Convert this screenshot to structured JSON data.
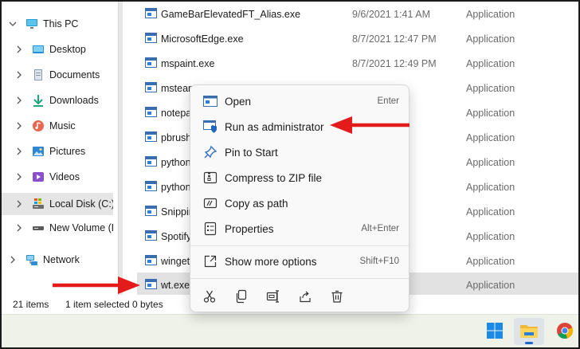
{
  "nav": {
    "items": [
      {
        "label": "This PC",
        "icon": "monitor-icon",
        "expanded": true
      },
      {
        "label": "Desktop",
        "icon": "desktop-icon"
      },
      {
        "label": "Documents",
        "icon": "documents-icon"
      },
      {
        "label": "Downloads",
        "icon": "download-icon"
      },
      {
        "label": "Music",
        "icon": "music-icon"
      },
      {
        "label": "Pictures",
        "icon": "pictures-icon"
      },
      {
        "label": "Videos",
        "icon": "videos-icon"
      },
      {
        "label": "Local Disk (C:)",
        "icon": "drive-icon",
        "selected": true
      },
      {
        "label": "New Volume (D",
        "icon": "drive-icon"
      },
      {
        "label": "Network",
        "icon": "network-icon"
      }
    ]
  },
  "files": [
    {
      "name": "GameBarElevatedFT_Alias.exe",
      "date": "9/6/2021 1:41 AM",
      "type": "Application"
    },
    {
      "name": "MicrosoftEdge.exe",
      "date": "8/7/2021 12:47 PM",
      "type": "Application"
    },
    {
      "name": "mspaint.exe",
      "date": "8/7/2021 12:49 PM",
      "type": "Application"
    },
    {
      "name": "msteam",
      "date": "",
      "type": "Application"
    },
    {
      "name": "notepa",
      "date": "",
      "type": "Application"
    },
    {
      "name": "pbrush",
      "date": "",
      "type": "Application"
    },
    {
      "name": "python",
      "date": "",
      "type": "Application"
    },
    {
      "name": "python",
      "date": "",
      "type": "Application"
    },
    {
      "name": "Snippin",
      "date": "",
      "type": "Application"
    },
    {
      "name": "Spotify",
      "date": "",
      "type": "Application"
    },
    {
      "name": "winget",
      "date": "",
      "type": "Application"
    },
    {
      "name": "wt.exe",
      "date": "",
      "type": "Application",
      "selected": true
    }
  ],
  "status": {
    "item_count": "21 items",
    "selected": "1 item selected",
    "size": "0 bytes"
  },
  "context_menu": {
    "items": [
      {
        "label": "Open",
        "shortcut": "Enter",
        "icon": "app-window-icon"
      },
      {
        "label": "Run as administrator",
        "shortcut": "",
        "icon": "shield-icon"
      },
      {
        "label": "Pin to Start",
        "shortcut": "",
        "icon": "pin-icon"
      },
      {
        "label": "Compress to ZIP file",
        "shortcut": "",
        "icon": "zip-icon"
      },
      {
        "label": "Copy as path",
        "shortcut": "",
        "icon": "copy-path-icon"
      },
      {
        "label": "Properties",
        "shortcut": "Alt+Enter",
        "icon": "properties-icon"
      },
      {
        "label": "Show more options",
        "shortcut": "Shift+F10",
        "icon": "more-options-icon"
      }
    ],
    "actions": [
      "cut-icon",
      "copy-icon",
      "rename-icon",
      "share-icon",
      "delete-icon"
    ]
  },
  "taskbar": {
    "items": [
      "windows-start-icon",
      "file-explorer-icon",
      "chrome-icon"
    ]
  },
  "colors": {
    "accent": "#1f66c1",
    "annotation": "#e31b1b",
    "selection": "#e2e2e2"
  }
}
